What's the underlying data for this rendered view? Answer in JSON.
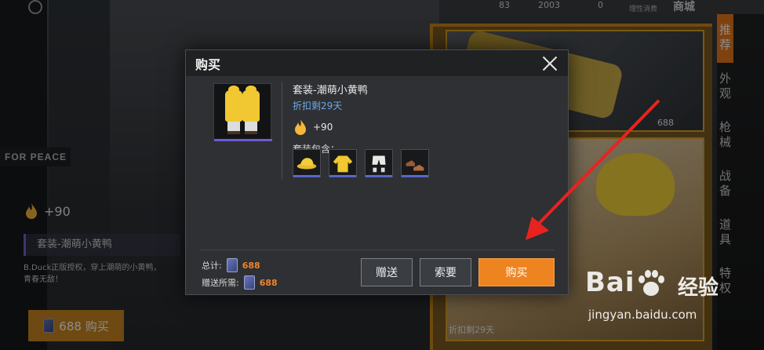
{
  "background": {
    "sign_text": "FOR PEACE",
    "top_resources": [
      "83",
      "2003",
      "0"
    ],
    "top_sub_label": "理性消费",
    "top_mall_title": "商城",
    "side_tabs": [
      {
        "label": "推荐",
        "active": true
      },
      {
        "label": "外观",
        "active": false
      },
      {
        "label": "枪械",
        "active": false
      },
      {
        "label": "战备",
        "active": false
      },
      {
        "label": "道具",
        "active": false
      },
      {
        "label": "特权",
        "active": false
      }
    ],
    "shop_prices": [
      "688",
      "折扣剩29天"
    ],
    "left_power": "+90",
    "left_item_name": "套装-潮萌小黄鸭",
    "left_desc": "B.Duck正版授权，穿上潮萌的小黄鸭，青春无敌！",
    "left_buy_label": "688 购买"
  },
  "dialog": {
    "title": "购买",
    "item_name": "套装-潮萌小黄鸭",
    "discount_text": "折扣剩29天",
    "power": "+90",
    "contains_label": "套装包含：",
    "parts": [
      {
        "name": "hat-icon"
      },
      {
        "name": "jacket-icon"
      },
      {
        "name": "shorts-icon"
      },
      {
        "name": "shoes-icon"
      }
    ],
    "total_label": "总计:",
    "total_value": "688",
    "gift_cost_label": "赠送所需:",
    "gift_cost_value": "688",
    "buttons": {
      "gift": "赠送",
      "request": "索要",
      "buy": "购买"
    },
    "accent_color": "#ee8420"
  },
  "watermark": {
    "logo_left": "Bai",
    "logo_cn": "经验",
    "url": "jingyan.baidu.com"
  }
}
